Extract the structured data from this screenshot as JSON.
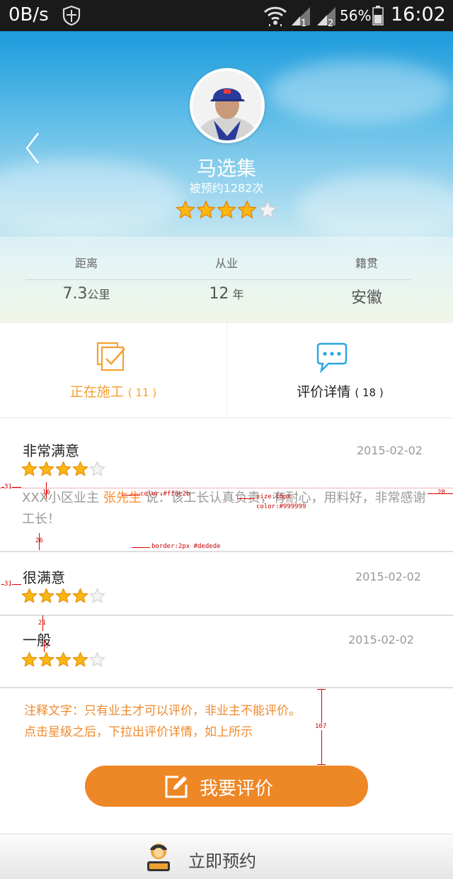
{
  "status_bar": {
    "speed": "0B/s",
    "battery": "56%",
    "time": "16:02",
    "signal_1": "1",
    "signal_2": "2"
  },
  "profile": {
    "name": "马选集",
    "booked_prefix": "被预约",
    "booked_count": "1282",
    "booked_suffix": "次",
    "rating": 4,
    "max_rating": 5
  },
  "info": [
    {
      "label": "距离",
      "value": "7.3",
      "unit": "公里"
    },
    {
      "label": "从业",
      "value": "12",
      "unit": "年"
    },
    {
      "label": "籍贯",
      "value": "安徽",
      "unit": ""
    }
  ],
  "tabs": {
    "working": {
      "label": "正在施工",
      "count": "( 11 )",
      "color": "#f5a030"
    },
    "reviews": {
      "label": "评价详情",
      "count": "( 18 )",
      "color": "#222222"
    }
  },
  "reviews": [
    {
      "title": "非常满意",
      "date": "2015-02-02",
      "rating": 4,
      "prefix": "XXX小区业主 ",
      "reviewer": "张先生",
      "text": " 说：该工长认真负责，有耐心，用料好，非常感谢工长！"
    },
    {
      "title": "很满意",
      "date": "2015-02-02",
      "rating": 4
    },
    {
      "title": "一般",
      "date": "2015-02-02",
      "rating": 4
    }
  ],
  "annotations": {
    "margin_left": "31",
    "gap_1": "16",
    "color_note": "color:#ff8c2b",
    "size_note": "size:18px",
    "color_note_2": "color:#999999",
    "margin_right": "28",
    "gap_2": "26",
    "border_note": "border:2px #dedede",
    "margin_left_2": "31",
    "gap_3": "21",
    "gap_4": "7",
    "height_note": "107"
  },
  "note": {
    "line1": "注释文字：只有业主才可以评价，非业主不能评价。",
    "line2": "点击星级之后，下拉出评价详情，如上所示"
  },
  "rate_button": {
    "label": "我要评价"
  },
  "bottom_bar": {
    "label": "立即预约"
  },
  "colors": {
    "accent": "#ee8726",
    "reviewer": "#ff8c2b",
    "text_muted": "#999999",
    "border": "#dedede",
    "chat_icon": "#29a5e3"
  }
}
